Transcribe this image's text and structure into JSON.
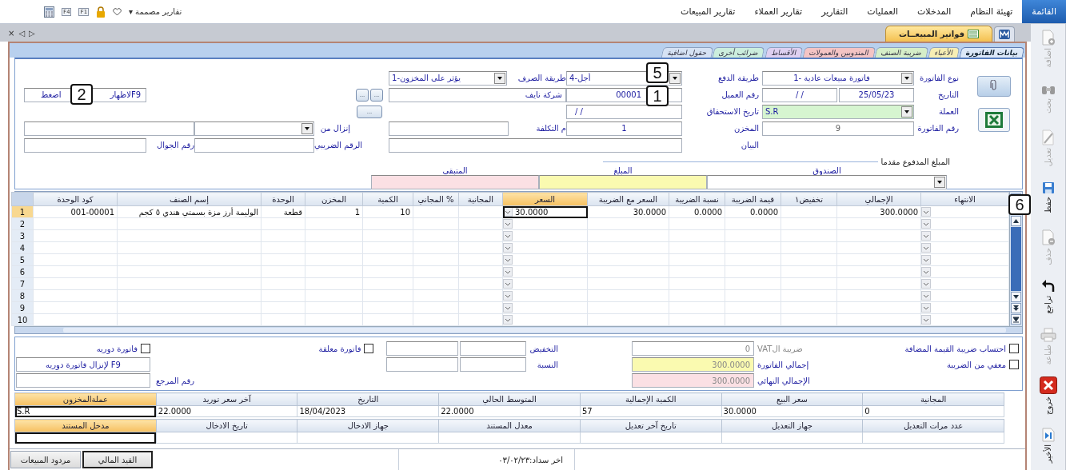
{
  "menu_bar": {
    "items": [
      {
        "label": "القائمة",
        "selected": true
      },
      {
        "label": "تهيئة النظام",
        "selected": false
      },
      {
        "label": "المدخلات",
        "selected": false
      },
      {
        "label": "العمليات",
        "selected": false
      },
      {
        "label": "التقارير",
        "selected": false
      },
      {
        "label": "تقارير العملاء",
        "selected": false
      },
      {
        "label": "تقارير المبيعات",
        "selected": false
      }
    ],
    "quick_bar": {
      "reports_menu": "تقارير مصممة ▾",
      "keys": [
        "F1",
        "F4"
      ]
    }
  },
  "document_bar": {
    "nav": [
      "▷",
      "◁",
      "×"
    ],
    "tab": "فواتير المبيعــات"
  },
  "side_toolbar": [
    {
      "kind": "add",
      "label": "اضافة",
      "disabled": true
    },
    {
      "kind": "search",
      "label": "بحث",
      "disabled": true
    },
    {
      "kind": "edit",
      "label": "تعديل",
      "disabled": true
    },
    {
      "kind": "save",
      "label": "حفظ",
      "disabled": false
    },
    {
      "kind": "delete",
      "label": "حذف",
      "disabled": true
    },
    {
      "kind": "undo",
      "label": "تراجع",
      "disabled": false
    },
    {
      "kind": "print",
      "label": "طباعة",
      "disabled": true
    },
    {
      "kind": "exit",
      "label": "خروج",
      "disabled": false
    },
    {
      "kind": "last",
      "label": "الأخير",
      "disabled": false
    }
  ],
  "section_tabs": [
    {
      "label": "بيانات الفاتورة",
      "selected": true,
      "color": "#dce8f8"
    },
    {
      "label": "الأعباء",
      "selected": false,
      "color": "#f6eeb4"
    },
    {
      "label": "ضريبة الصنف",
      "selected": false,
      "color": "#d6eec8"
    },
    {
      "label": "المندوبين والعمولات",
      "selected": false,
      "color": "#f4c4c4"
    },
    {
      "label": "الأقساط",
      "selected": false,
      "color": "#ded0f0"
    },
    {
      "label": "ضرائب أخرى",
      "selected": false,
      "color": "#cceedd"
    },
    {
      "label": "حقول اضافية",
      "selected": false,
      "color": "#d6e2f4"
    }
  ],
  "form": {
    "invoice_type": {
      "label": "نوع الفاتورة",
      "value": "فاتورة مبيعات عادية -1"
    },
    "date": {
      "label": "التاريخ",
      "value": "25/05/23",
      "second_value": "/ /"
    },
    "currency": {
      "label": "العملة",
      "value": "S.R"
    },
    "invoice_number": {
      "label": "رقم الفاتورة",
      "value": "9"
    },
    "payment_method": {
      "label": "طريقة الدفع",
      "value": "أجل-4"
    },
    "customer_number": {
      "label": "رقم العميل",
      "value": "00001"
    },
    "due_date": {
      "label": "تاريخ الاستحقاق",
      "value": "/ /"
    },
    "warehouse": {
      "label": "المخزن",
      "value": "1"
    },
    "description": {
      "label": "البيان"
    },
    "issue_method": {
      "label": "طريقة الصرف",
      "value": "يؤثر على المخزون-1"
    },
    "customer_name": {
      "value": "شركة نايف"
    },
    "cost_center": {
      "label": "م التكلفة"
    },
    "lookup_buttons": [
      "...",
      "...",
      "..."
    ],
    "hint_field": {
      "parts": [
        "F9لاظهار",
        "اضغط"
      ]
    },
    "load_from": {
      "label": "إنزال من"
    },
    "tax_number": {
      "label": "الرقم الضريبي"
    },
    "mobile": {
      "label": "رقم الجوال"
    },
    "advance": {
      "title": "المبلغ المدفوع مقدما",
      "columns": [
        "الصندوق",
        "المبلغ",
        "المتبقي"
      ]
    }
  },
  "items_grid": {
    "columns": [
      {
        "label": "الانتهاء",
        "kind": "dropdown",
        "selected": false
      },
      {
        "label": "الإجمالي",
        "kind": "text",
        "selected": false
      },
      {
        "label": "تخفيض١",
        "kind": "text",
        "selected": false
      },
      {
        "label": "قيمة الضريبة",
        "kind": "text",
        "selected": false
      },
      {
        "label": "نسبة الضريبة",
        "kind": "text",
        "selected": false
      },
      {
        "label": "السعر مع الضريبة",
        "kind": "text",
        "selected": false
      },
      {
        "label": "السعر",
        "kind": "dropdown",
        "selected": true
      },
      {
        "label": "المجانية",
        "kind": "text",
        "selected": false
      },
      {
        "label": "% المجاني",
        "kind": "text",
        "selected": false
      },
      {
        "label": "الكمية",
        "kind": "text",
        "selected": false
      },
      {
        "label": "المخزن",
        "kind": "text",
        "selected": false
      },
      {
        "label": "الوحدة",
        "kind": "text",
        "selected": false
      },
      {
        "label": "إسم الصنف",
        "kind": "text",
        "selected": false
      },
      {
        "label": "كود الوحدة",
        "kind": "text",
        "selected": false
      }
    ],
    "rows": [
      {
        "number": "1",
        "selected": true,
        "cells": [
          null,
          "300.0000",
          null,
          "0.0000",
          "0.0000",
          "30.0000",
          "30.0000",
          null,
          null,
          "10",
          "1",
          "قطعة",
          "الوليمة أرز مزة بسمتي هندي ٥ كجم",
          "001-00001"
        ]
      },
      {
        "number": "2",
        "selected": false
      },
      {
        "number": "3",
        "selected": false
      },
      {
        "number": "4",
        "selected": false
      },
      {
        "number": "5",
        "selected": false
      },
      {
        "number": "6",
        "selected": false
      },
      {
        "number": "7",
        "selected": false
      },
      {
        "number": "8",
        "selected": false
      },
      {
        "number": "9",
        "selected": false
      },
      {
        "number": "10",
        "selected": false
      }
    ]
  },
  "totals": {
    "vat_checkbox": {
      "label": "احتساب ضريبة القيمة المضافة",
      "checked": false
    },
    "exempt_checkbox": {
      "label": "معفي من الضريبة",
      "checked": false
    },
    "vat": {
      "label": "ضريبة الVAT",
      "value": "0",
      "disabled": true
    },
    "invoice_total": {
      "label": "إجمالي الفاتورة",
      "value": "300.0000"
    },
    "final_total": {
      "label": "الإجمالي النهائي",
      "value": "300.0000"
    },
    "discount_label": "التخفيض",
    "ratio_label": "النسبة",
    "suspended_checkbox": {
      "label": "فاتورة معلقة",
      "checked": false
    },
    "periodic_checkbox": {
      "label": "فاتورة دوريه",
      "checked": false
    },
    "periodic_hint": "F9 لإنزال فاتورة دوريه",
    "reference_label": "رقم المرجع"
  },
  "info_grids": [
    {
      "columns": [
        {
          "label": "المجانية",
          "selected": false
        },
        {
          "label": "سعر البيع",
          "selected": false
        },
        {
          "label": "الكمية الإجمالية",
          "selected": false
        },
        {
          "label": "المتوسط الحالي",
          "selected": false
        },
        {
          "label": "التاريخ",
          "selected": false
        },
        {
          "label": "آخر سعر توريد",
          "selected": false
        },
        {
          "label": "عملةالمخزون",
          "selected": true
        }
      ],
      "values": [
        "0",
        "30.0000",
        "57",
        "22.0000",
        "18/04/2023",
        "22.0000",
        "S.R"
      ]
    },
    {
      "columns": [
        {
          "label": "عدد مرات التعديل",
          "selected": false
        },
        {
          "label": "جهاز التعديل",
          "selected": false
        },
        {
          "label": "تاريخ آخر تعديل",
          "selected": false
        },
        {
          "label": "معدل المستند",
          "selected": false
        },
        {
          "label": "جهاز الادخال",
          "selected": false
        },
        {
          "label": "تاريخ الادخال",
          "selected": false
        },
        {
          "label": "مدخل المستند",
          "selected": true
        }
      ]
    }
  ],
  "status_bar": {
    "buttons": [
      {
        "label": "القيد المالي",
        "selected": true
      },
      {
        "label": "مردود المبيعات",
        "selected": false
      }
    ],
    "last_payment": "اخر سداد:٠٣/٠٢/٢٣"
  },
  "callouts": [
    "5",
    "1",
    "2",
    "6"
  ]
}
